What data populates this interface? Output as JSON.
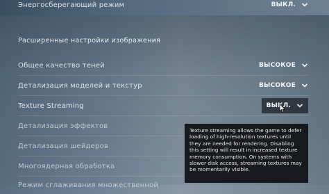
{
  "settings": {
    "power_saving": {
      "label": "Энергосберегающий режим",
      "value": "ВЫКЛ."
    },
    "advanced_section_title": "Расширенные настройки изображения",
    "shadow_quality": {
      "label": "Общее качество теней",
      "value": "ВЫСОКОЕ"
    },
    "model_texture_detail": {
      "label": "Детализация моделей и текстур",
      "value": "ВЫСОКОЕ"
    },
    "texture_streaming": {
      "label": "Texture Streaming",
      "value": "ВЫКЛ."
    },
    "effect_detail": {
      "label": "Детализация эффектов"
    },
    "shader_detail": {
      "label": "Детализация шейдеров"
    },
    "multicore_rendering": {
      "label": "Многоядерная обработка"
    },
    "multisampling_mode": {
      "label": "Режим сглаживания множественной"
    }
  },
  "tooltip": {
    "text": "Texture streaming allows the game to defer loading of high-resolution textures until they are needed for rendering. Disabling this setting will result in increased texture memory consumption. On systems with slower disk access, streaming textures may be momentarily visible."
  },
  "icons": {
    "dropdown": "chevron-down-icon",
    "cursor": "mouse-pointer-icon"
  }
}
